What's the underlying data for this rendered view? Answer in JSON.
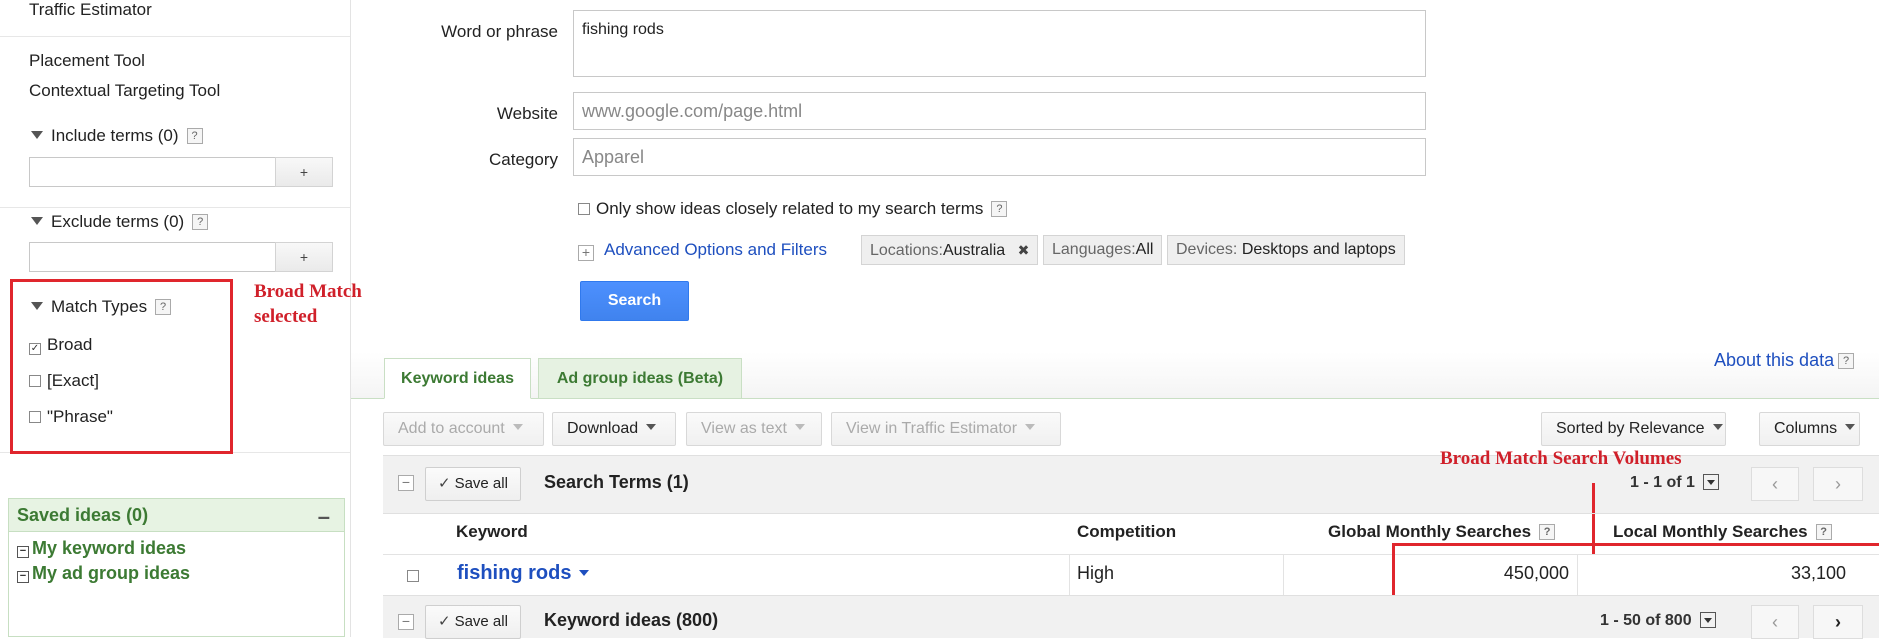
{
  "sidebar": {
    "traffic_estimator": "Traffic Estimator",
    "placement_tool": "Placement Tool",
    "contextual_tool": "Contextual Targeting Tool",
    "include_terms": "Include terms (0)",
    "exclude_terms": "Exclude terms (0)",
    "plus": "+",
    "help": "?",
    "match_types": {
      "title": "Match Types",
      "options": [
        {
          "label": "Broad",
          "checked": true
        },
        {
          "label": "[Exact]",
          "checked": false
        },
        {
          "label": "\"Phrase\"",
          "checked": false
        }
      ]
    },
    "saved": {
      "title": "Saved ideas (0)",
      "collapse": "–",
      "items": [
        "My keyword ideas",
        "My ad group ideas"
      ]
    }
  },
  "annotations": {
    "broad_line1": "Broad Match",
    "broad_line2": "selected",
    "volumes": "Broad Match Search Volumes"
  },
  "form": {
    "word_label": "Word or phrase",
    "word_value": "fishing rods",
    "website_label": "Website",
    "website_placeholder": "www.google.com/page.html",
    "category_label": "Category",
    "category_placeholder": "Apparel",
    "only_related": "Only show ideas closely related to my search terms",
    "advanced": "Advanced Options and Filters",
    "chips": {
      "locations_key": "Locations:",
      "locations_val": "Australia",
      "languages_key": "Languages:",
      "languages_val": "All",
      "devices_key": "Devices:",
      "devices_val": "Desktops and laptops"
    },
    "search_button": "Search"
  },
  "tabs": [
    "Keyword ideas",
    "Ad group ideas (Beta)"
  ],
  "about": "About this data",
  "toolbar": {
    "add_to_account": "Add to account",
    "download": "Download",
    "view_as_text": "View as text",
    "view_in_traffic": "View in Traffic Estimator",
    "sorted_by": "Sorted by Relevance",
    "columns": "Columns"
  },
  "search_terms": {
    "save_all": "Save all",
    "title": "Search Terms (1)",
    "range": "1 - 1 of 1"
  },
  "table": {
    "headers": [
      "Keyword",
      "Competition",
      "Global Monthly Searches",
      "Local Monthly Searches"
    ],
    "rows": [
      {
        "keyword": "fishing rods",
        "competition": "High",
        "global": "450,000",
        "local": "33,100"
      }
    ]
  },
  "keyword_ideas": {
    "save_all": "Save all",
    "title": "Keyword ideas (800)",
    "range": "1 - 50 of 800"
  },
  "icons": {
    "check": "✓",
    "close": "✖",
    "prev": "‹",
    "next": "›",
    "expand": "+",
    "collapse": "−"
  }
}
